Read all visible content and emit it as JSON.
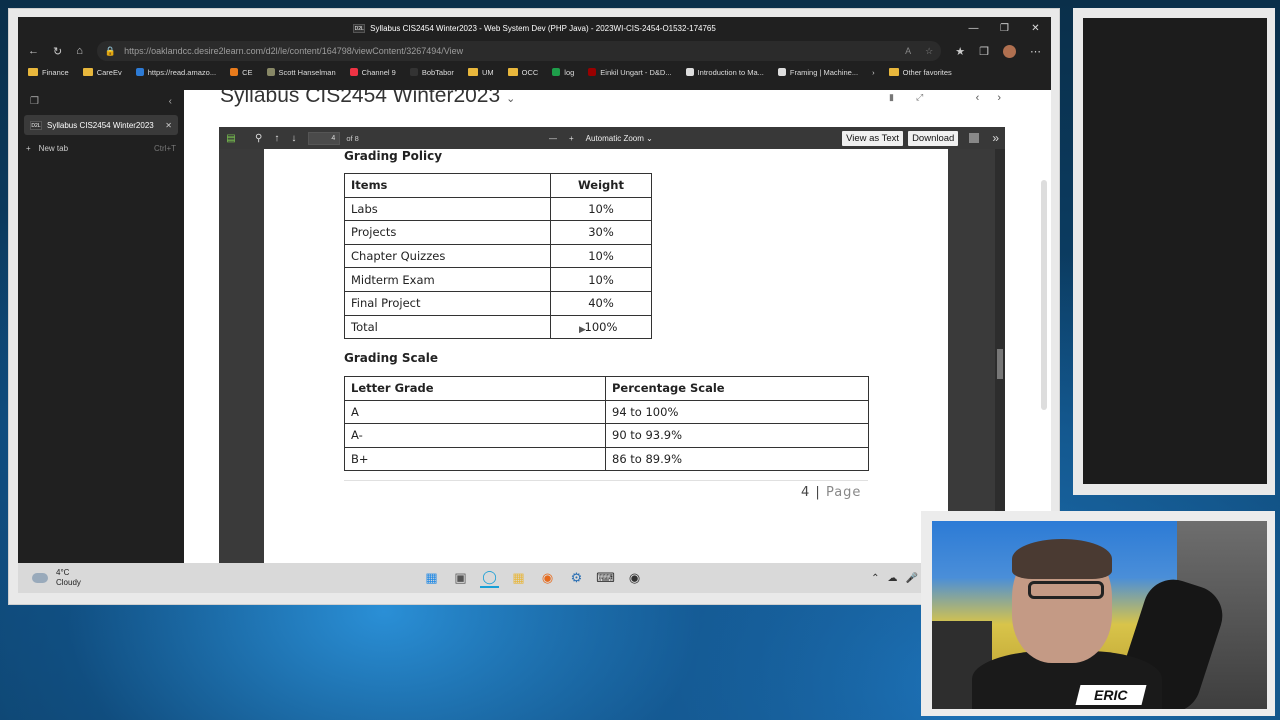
{
  "browser": {
    "window_title": "Syllabus CIS2454 Winter2023 - Web System Dev (PHP Java) - 2023WI-CIS-2454-O1532-174765",
    "favicon_text": "D2L",
    "url": "https://oaklandcc.desire2learn.com/d2l/le/content/164798/viewContent/3267494/View",
    "favorites": [
      {
        "label": "Finance",
        "icon": "folder-icon"
      },
      {
        "label": "CareEv",
        "icon": "folder-icon"
      },
      {
        "label": "https://read.amazo...",
        "icon": "kindle-icon"
      },
      {
        "label": "CE",
        "icon": "gear-icon"
      },
      {
        "label": "Scott Hanselman",
        "icon": "site-icon"
      },
      {
        "label": "Channel 9",
        "icon": "microsoft-icon"
      },
      {
        "label": "BobTabor",
        "icon": "site-icon"
      },
      {
        "label": "UM",
        "icon": "folder-icon"
      },
      {
        "label": "OCC",
        "icon": "folder-icon"
      },
      {
        "label": "log",
        "icon": "sheets-icon"
      },
      {
        "label": "Einkil Ungart - D&D...",
        "icon": "site-icon"
      },
      {
        "label": "Introduction to Ma...",
        "icon": "site-icon"
      },
      {
        "label": "Framing | Machine...",
        "icon": "site-icon"
      }
    ],
    "other_favorites": "Other favorites",
    "sidebar": {
      "tab_label": "Syllabus CIS2454 Winter2023",
      "new_tab_label": "New tab",
      "new_tab_shortcut": "Ctrl+T"
    }
  },
  "content": {
    "heading": "Syllabus CIS2454 Winter2023"
  },
  "pdf_toolbar": {
    "page_number": "4",
    "page_total": "of 8",
    "zoom": "Automatic Zoom",
    "view_as_text": "View as Text",
    "download": "Download"
  },
  "pdf_page": {
    "grading_policy_title": "Grading Policy",
    "policy_headers": [
      "Items",
      "Weight"
    ],
    "policy_rows": [
      [
        "Labs",
        "10%"
      ],
      [
        "Projects",
        "30%"
      ],
      [
        "Chapter Quizzes",
        "10%"
      ],
      [
        "Midterm Exam",
        "10%"
      ],
      [
        "Final Project",
        "40%"
      ],
      [
        "Total",
        "100%"
      ]
    ],
    "grading_scale_title": "Grading Scale",
    "scale_headers": [
      "Letter Grade",
      "Percentage Scale"
    ],
    "scale_rows": [
      [
        "A",
        "94 to 100%"
      ],
      [
        "A-",
        "90 to 93.9%"
      ],
      [
        "B+",
        "86 to 89.9%"
      ]
    ],
    "page_footer_number": "4 |",
    "page_footer_word": "Page"
  },
  "taskbar": {
    "temperature": "4°C",
    "condition": "Cloudy"
  },
  "webcam": {
    "name": "ERIC"
  },
  "colors": {
    "browser_dark": "#202020",
    "pdf_toolbar": "#383838",
    "page_white": "#ffffff",
    "accent_folder": "#e8b73c"
  }
}
